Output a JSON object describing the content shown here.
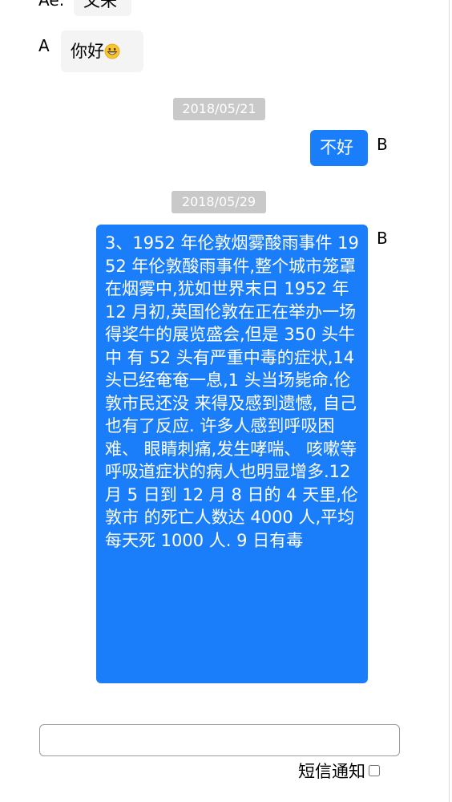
{
  "chat": {
    "top_partial": {
      "sender": "Ae:",
      "text": "文来"
    },
    "messages": [
      {
        "sender": "A",
        "text": "你好",
        "emoji": "grinning-face-icon"
      },
      {
        "date": "2018/05/21"
      },
      {
        "sender": "B",
        "text": "不好"
      },
      {
        "date": "2018/05/29"
      },
      {
        "sender": "B",
        "text": "3、1952 年伦敦烟雾酸雨事件 1952 年伦敦酸雨事件,整个城市笼罩在烟雾中,犹如世界末日 1952 年 12 月初,英国伦敦在正在举办一场得奖牛的展览盛会,但是 350 头牛中 有 52 头有严重中毒的症状,14 头已经奄奄一息,1 头当场毙命.伦敦市民还没 来得及感到遗憾, 自己也有了反应. 许多人感到呼吸困难、 眼睛刺痛,发生哮喘、 咳嗽等呼吸道症状的病人也明显增多.12 月 5 日到 12 月 8 日的 4 天里,伦敦市 的死亡人数达 4000 人,平均每天死 1000 人. 9 日有毒"
      }
    ]
  },
  "composer": {
    "input_value": "",
    "sms_label": "短信通知",
    "sms_checked": false
  },
  "colors": {
    "outgoing_bubble": "#1a7efb",
    "incoming_bubble": "#f4f4f4",
    "date_chip": "#c9c9c9"
  }
}
